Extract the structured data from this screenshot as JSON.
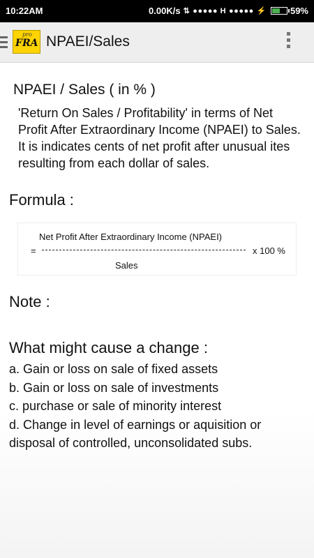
{
  "status_bar": {
    "time": "10:22AM",
    "network_speed": "0.00K/s",
    "signal_1": "●●●●● H",
    "signal_2": "●●●●●",
    "battery": "59%",
    "battery_level": 0.59
  },
  "app_bar": {
    "logo_small": "pro",
    "logo_main": "FRA",
    "title": "NPAEI/Sales"
  },
  "content": {
    "heading": "NPAEI / Sales ( in % )",
    "description": "'Return On Sales / Profitability' in terms of Net Profit After Extraordinary Income (NPAEI) to Sales. It is indicates cents of net profit after unusual ites resulting from each dollar of sales.",
    "formula_label": "Formula :",
    "formula": {
      "numerator": "Net Profit After Extraordinary Income (NPAEI)",
      "equals": "=",
      "multiplier": "x  100 %",
      "denominator": "Sales"
    },
    "note_label": "Note :",
    "change_label": "What might cause a change :",
    "change_items": [
      " a. Gain or loss on sale of fixed assets",
      " b. Gain or loss on sale of investments",
      " c. purchase or sale of minority interest",
      " d. Change in level of earnings or aquisition or disposal of controlled, unconsolidated subs."
    ]
  },
  "colors": {
    "status_bar_bg": "#000000",
    "app_bar_bg": "#eeeeee",
    "logo_bg": "#ffd400",
    "battery_fill": "#4caf50"
  },
  "icons": {
    "menu": "hamburger-menu-icon",
    "overflow": "more-vert-icon"
  }
}
